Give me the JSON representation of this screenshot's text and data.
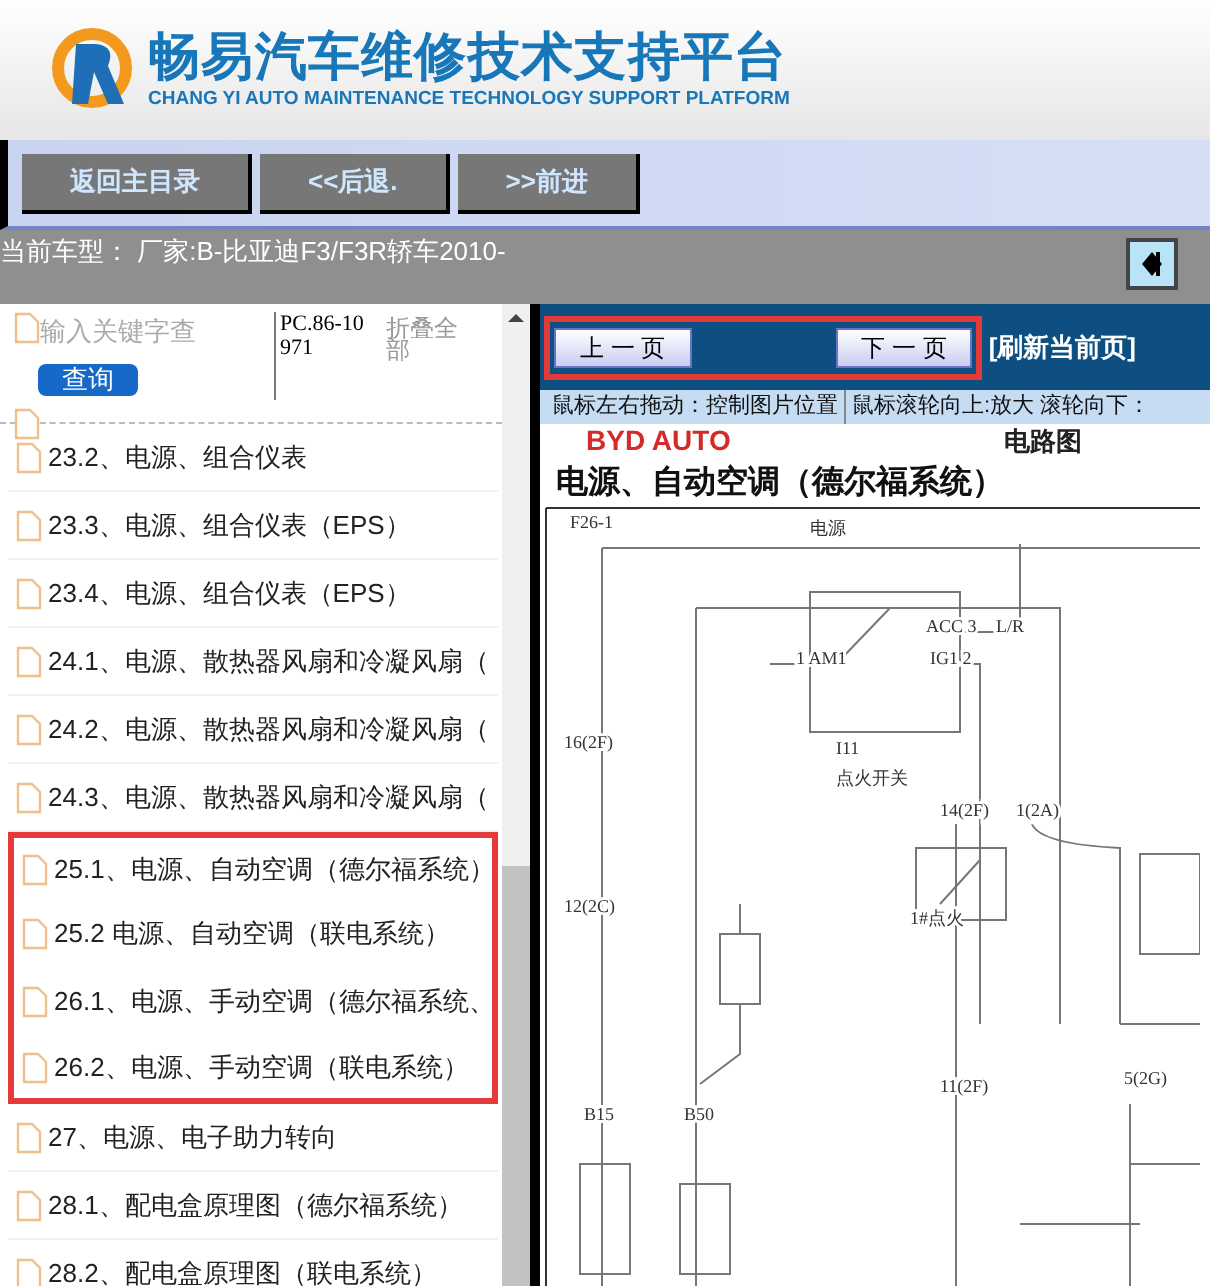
{
  "header": {
    "title": "畅易汽车维修技术支持平台",
    "subtitle": "CHANG YI AUTO MAINTENANCE TECHNOLOGY SUPPORT PLATFORM"
  },
  "nav_buttons": [
    "返回主目录",
    "<<后退.",
    ">>前进"
  ],
  "car_model": "当前车型： 厂家:B-比亚迪F3/F3R轿车2010-",
  "sidebar": {
    "search": {
      "placeholder": "输入关键字查",
      "button": "查询"
    },
    "code": "PC.86-10971",
    "collapse_all": "折叠全部",
    "items": [
      {
        "label": "23.2、电源、组合仪表",
        "highlighted": false
      },
      {
        "label": "23.3、电源、组合仪表（EPS）",
        "highlighted": false
      },
      {
        "label": "23.4、电源、组合仪表（EPS）",
        "highlighted": false
      },
      {
        "label": "24.1、电源、散热器风扇和冷凝风扇（",
        "highlighted": false
      },
      {
        "label": "24.2、电源、散热器风扇和冷凝风扇（",
        "highlighted": false
      },
      {
        "label": "24.3、电源、散热器风扇和冷凝风扇（",
        "highlighted": false
      },
      {
        "label": "25.1、电源、自动空调（德尔福系统）",
        "highlighted": true
      },
      {
        "label": "25.2 电源、自动空调（联电系统）",
        "highlighted": true
      },
      {
        "label": "26.1、电源、手动空调（德尔福系统、",
        "highlighted": true
      },
      {
        "label": "26.2、电源、手动空调（联电系统）",
        "highlighted": true
      },
      {
        "label": "27、电源、电子助力转向",
        "highlighted": false
      },
      {
        "label": "28.1、配电盒原理图（德尔福系统）",
        "highlighted": false
      },
      {
        "label": "28.2、配电盒原理图（联电系统）",
        "highlighted": false
      }
    ]
  },
  "viewer": {
    "prev": "上 一 页",
    "next": "下 一 页",
    "pager_highlighted": true,
    "refresh": "[刷新当前页]",
    "hints": [
      "鼠标左右拖动：控制图片位置",
      "鼠标滚轮向上:放大  滚轮向下："
    ],
    "diagram": {
      "brand": "BYD AUTO",
      "type": "电路图",
      "title": "电源、自动空调（德尔福系统）",
      "labels": [
        "F26-1",
        "电源",
        "ACC 3",
        "L/R",
        "1 AM1",
        "IG1 2",
        "I11",
        "点火开关",
        "16(2F)",
        "14(2F)",
        "1(2A)",
        "12(2C)",
        "1#点火",
        "11(2F)",
        "5(2G)",
        "B15",
        "B50"
      ]
    }
  }
}
